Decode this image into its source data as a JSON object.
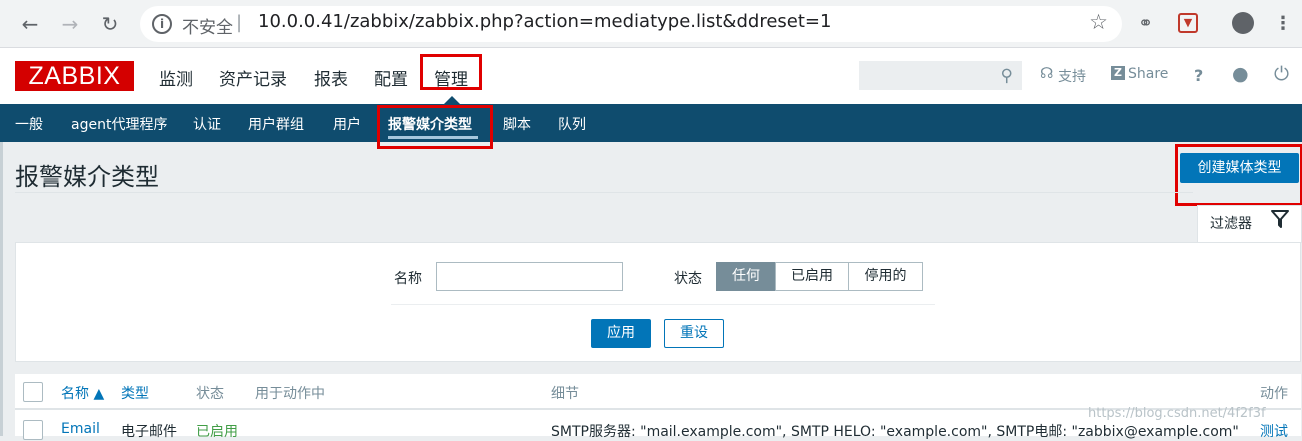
{
  "browser": {
    "back_icon": "arrow-left-icon",
    "forward_icon": "arrow-right-icon",
    "reload_icon": "reload-icon",
    "security_label": "不安全",
    "url": "10.0.0.41/zabbix/zabbix.php?action=mediatype.list&ddreset=1"
  },
  "header": {
    "logo": "ZABBIX",
    "menu": [
      "监测",
      "资产记录",
      "报表",
      "配置",
      "管理"
    ],
    "support_label": "支持",
    "share_label": "Share",
    "help_label": "?"
  },
  "submenu": [
    "一般",
    "agent代理程序",
    "认证",
    "用户群组",
    "用户",
    "报警媒介类型",
    "脚本",
    "队列"
  ],
  "page": {
    "title": "报警媒介类型",
    "create_button": "创建媒体类型",
    "filter_tab": "过滤器"
  },
  "filter": {
    "name_label": "名称",
    "name_value": "",
    "status_label": "状态",
    "status_options": [
      "任何",
      "已启用",
      "停用的"
    ],
    "status_selected": "任何",
    "apply_button": "应用",
    "reset_button": "重设"
  },
  "table": {
    "columns": [
      "名称 ▲",
      "类型",
      "状态",
      "用于动作中",
      "细节",
      "动作"
    ],
    "rows": [
      {
        "name": "Email",
        "type": "电子邮件",
        "status": "已启用",
        "used_in_actions": "",
        "details": "SMTP服务器: \"mail.example.com\", SMTP HELO: \"example.com\", SMTP电邮: \"zabbix@example.com\"",
        "action": "测试"
      }
    ]
  },
  "watermark": "https://blog.csdn.net/4f2f3f"
}
